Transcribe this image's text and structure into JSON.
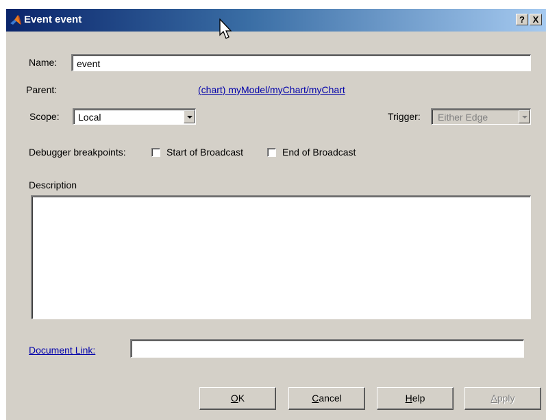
{
  "window": {
    "title": "Event event",
    "help_button": "?",
    "close_button": "X"
  },
  "form": {
    "name_label": "Name:",
    "name_value": "event",
    "parent_label": "Parent:",
    "parent_link": "(chart) myModel/myChart/myChart",
    "scope_label": "Scope:",
    "scope_value": "Local",
    "trigger_label": "Trigger:",
    "trigger_value": "Either Edge",
    "debugger_label": "Debugger breakpoints:",
    "start_broadcast_label": "Start of Broadcast",
    "start_broadcast_checked": false,
    "end_broadcast_label": "End of Broadcast",
    "end_broadcast_checked": false,
    "description_label": "Description",
    "description_value": "",
    "document_link_label": "Document Link:",
    "document_link_value": ""
  },
  "buttons": {
    "ok": {
      "mnemonic": "O",
      "rest": "K"
    },
    "cancel": {
      "mnemonic": "C",
      "rest": "ancel"
    },
    "help": {
      "mnemonic": "H",
      "rest": "elp"
    },
    "apply": {
      "mnemonic": "A",
      "rest": "pply"
    }
  },
  "colors": {
    "title_start": "#0a246a",
    "title_end": "#a6caf0",
    "face": "#d4d0c8",
    "link": "#0000aa"
  }
}
